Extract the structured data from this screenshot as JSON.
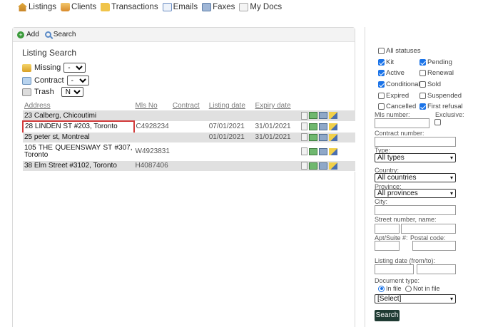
{
  "nav": {
    "listings": "Listings",
    "clients": "Clients",
    "transactions": "Transactions",
    "emails": "Emails",
    "faxes": "Faxes",
    "mydocs": "My Docs"
  },
  "toolbar": {
    "add": "Add",
    "search": "Search"
  },
  "panel": {
    "title": "Listing Search"
  },
  "filters": {
    "missing": {
      "label": "Missing",
      "value": "-"
    },
    "contract": {
      "label": "Contract",
      "value": "-"
    },
    "trash": {
      "label": "Trash",
      "value": "No"
    }
  },
  "table": {
    "headers": [
      "Address",
      "Mls No",
      "Contract",
      "Listing date",
      "Expiry date"
    ],
    "rows": [
      {
        "address": "23 Calberg, Chicoutimi",
        "mls": "",
        "contract": "",
        "listing": "",
        "expiry": ""
      },
      {
        "address": "28 LINDEN ST #203, Toronto",
        "mls": "C4928234",
        "contract": "",
        "listing": "07/01/2021",
        "expiry": "31/01/2021"
      },
      {
        "address": "25 peter st, Montreal",
        "mls": "",
        "contract": "",
        "listing": "01/01/2021",
        "expiry": "31/01/2021"
      },
      {
        "address": "105 THE QUEENSWAY ST #307, Toronto",
        "mls": "W4923831",
        "contract": "",
        "listing": "",
        "expiry": ""
      },
      {
        "address": "38 Elm Street #3102, Toronto",
        "mls": "H4087406",
        "contract": "",
        "listing": "",
        "expiry": ""
      }
    ]
  },
  "statuses": {
    "all": "All statuses",
    "kit": "Kit",
    "pending": "Pending",
    "active": "Active",
    "renewal": "Renewal",
    "conditional": "Conditional",
    "sold": "Sold",
    "expired": "Expired",
    "suspended": "Suspended",
    "cancelled": "Cancelled",
    "first_refusal": "First refusal"
  },
  "form": {
    "mls_label": "Mls number:",
    "exclusive_label": "Exclusive:",
    "contract_label": "Contract number:",
    "type_label": "Type:",
    "type_value": "All types",
    "country_label": "Country:",
    "country_value": "All countries",
    "province_label": "Province:",
    "province_value": "All provinces",
    "city_label": "City:",
    "street_label": "Street number, name:",
    "apt_label": "Apt/Suite #:",
    "postal_label": "Postal code:",
    "date_label": "Listing date (from/to):",
    "doctype_label": "Document type:",
    "in_file": "In file",
    "not_in_file": "Not in file",
    "doc_select": "[Select]",
    "search_button": "Search"
  }
}
